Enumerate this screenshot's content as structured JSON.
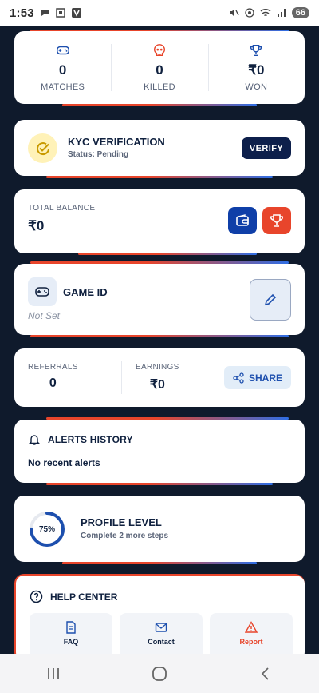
{
  "status_bar": {
    "time": "1:53",
    "battery": "66"
  },
  "stats": [
    {
      "icon": "gamepad-icon",
      "value": "0",
      "label": "MATCHES"
    },
    {
      "icon": "skull-icon",
      "value": "0",
      "label": "KILLED"
    },
    {
      "icon": "trophy-icon",
      "value": "₹0",
      "label": "WON"
    }
  ],
  "kyc": {
    "title": "KYC VERIFICATION",
    "status": "Status: Pending",
    "button": "VERIFY"
  },
  "balance": {
    "label": "TOTAL BALANCE",
    "value": "₹0"
  },
  "game_id": {
    "title": "GAME ID",
    "value": "Not Set"
  },
  "referrals": {
    "referrals_label": "REFERRALS",
    "referrals_value": "0",
    "earnings_label": "EARNINGS",
    "earnings_value": "₹0",
    "share_label": "SHARE"
  },
  "alerts": {
    "title": "ALERTS HISTORY",
    "empty": "No recent alerts"
  },
  "profile": {
    "progress_text": "75%",
    "progress": 0.75,
    "title": "PROFILE LEVEL",
    "subtitle": "Complete 2 more steps"
  },
  "help": {
    "title": "HELP CENTER",
    "tiles": [
      {
        "label": "FAQ"
      },
      {
        "label": "Contact"
      },
      {
        "label": "Report"
      }
    ]
  },
  "colors": {
    "accent_red": "#e8452b",
    "accent_blue": "#2f6ee5",
    "navy": "#0d1f4b",
    "bg": "#0f1a2c"
  }
}
